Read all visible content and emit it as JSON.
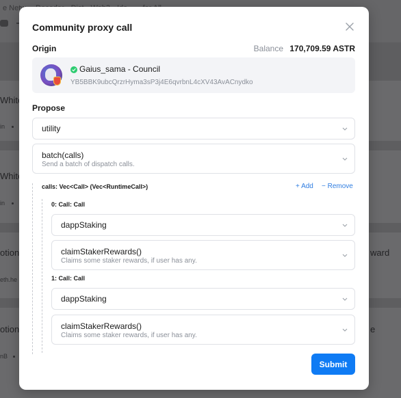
{
  "background": {
    "breadcrumb": "e Netw• • Decoder • Dist • Web3 • Ide • ... for All",
    "row_labels": [
      "Whitel",
      "Whitel",
      "otion",
      "otion"
    ],
    "row_subs": [
      "in",
      "in",
      "eth.he",
      "nB"
    ],
    "right_labels": [
      "ward",
      "e"
    ]
  },
  "modal": {
    "title": "Community proxy call",
    "origin_label": "Origin",
    "balance_label": "Balance",
    "balance_value": "170,709.59 ASTR",
    "account": {
      "name": "Gaius_sama - Council",
      "address": "YB5BBK9ubcQrzrHyma3sP3j4E6qvrbnL4cXV43AvACnydko"
    },
    "propose_label": "Propose",
    "pallet_select": "utility",
    "method_select": {
      "name": "batch(calls)",
      "description": "Send a batch of dispatch calls."
    },
    "calls_header": "calls: Vec<Call> (Vec<RuntimeCall>)",
    "add_label": "+ Add",
    "remove_label": "− Remove",
    "calls": [
      {
        "label": "0: Call: Call",
        "pallet": "dappStaking",
        "method": "claimStakerRewards()",
        "description": "Claims some staker rewards, if user has any."
      },
      {
        "label": "1: Call: Call",
        "pallet": "dappStaking",
        "method": "claimStakerRewards()",
        "description": "Claims some staker rewards, if user has any."
      }
    ],
    "submit_label": "Submit"
  },
  "colors": {
    "accent": "#0f7bf4",
    "link": "#2f7de1",
    "verified": "#2ecc71"
  },
  "icons": [
    "close-icon",
    "verified-check-icon",
    "chevron-down-icon"
  ]
}
